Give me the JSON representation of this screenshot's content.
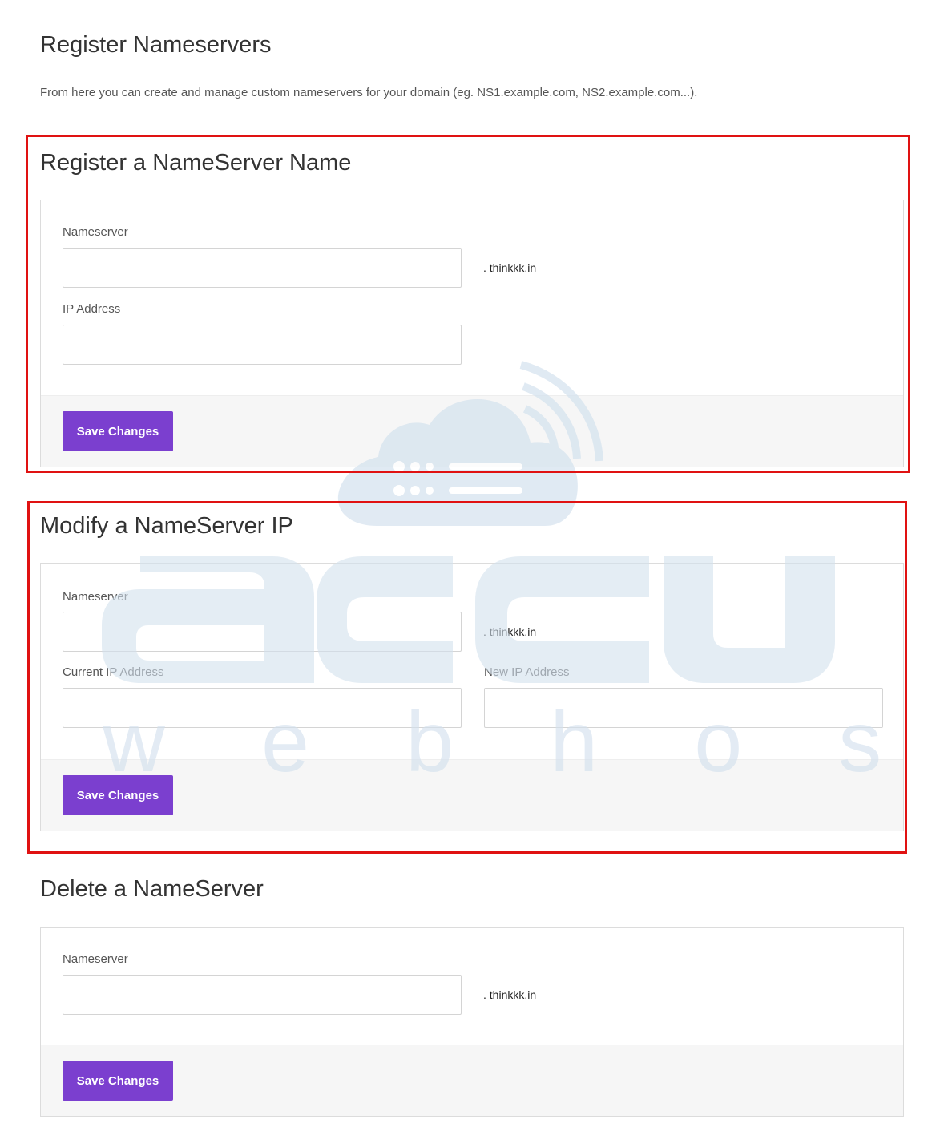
{
  "page": {
    "title": "Register Nameservers",
    "description": "From here you can create and manage custom nameservers for your domain (eg. NS1.example.com, NS2.example.com...)."
  },
  "register": {
    "title": "Register a NameServer Name",
    "nameserver_label": "Nameserver",
    "nameserver_value": "",
    "suffix": ". thinkkk.in",
    "ip_label": "IP Address",
    "ip_value": "",
    "save_label": "Save Changes"
  },
  "modify": {
    "title": "Modify a NameServer IP",
    "nameserver_label": "Nameserver",
    "nameserver_value": "",
    "suffix": ". thinkkk.in",
    "current_ip_label": "Current IP Address",
    "current_ip_value": "",
    "new_ip_label": "New IP Address",
    "new_ip_value": "",
    "save_label": "Save Changes"
  },
  "delete": {
    "title": "Delete a NameServer",
    "nameserver_label": "Nameserver",
    "nameserver_value": "",
    "suffix": ". thinkkk.in",
    "save_label": "Save Changes"
  },
  "watermark": {
    "word": "accu",
    "tagline": "w e b   h o s t i n g",
    "icon": "cloud-server-wifi-icon",
    "color": "#d3e1ee"
  },
  "colors": {
    "button": "#7b3fcf",
    "highlight": "#e01212"
  }
}
